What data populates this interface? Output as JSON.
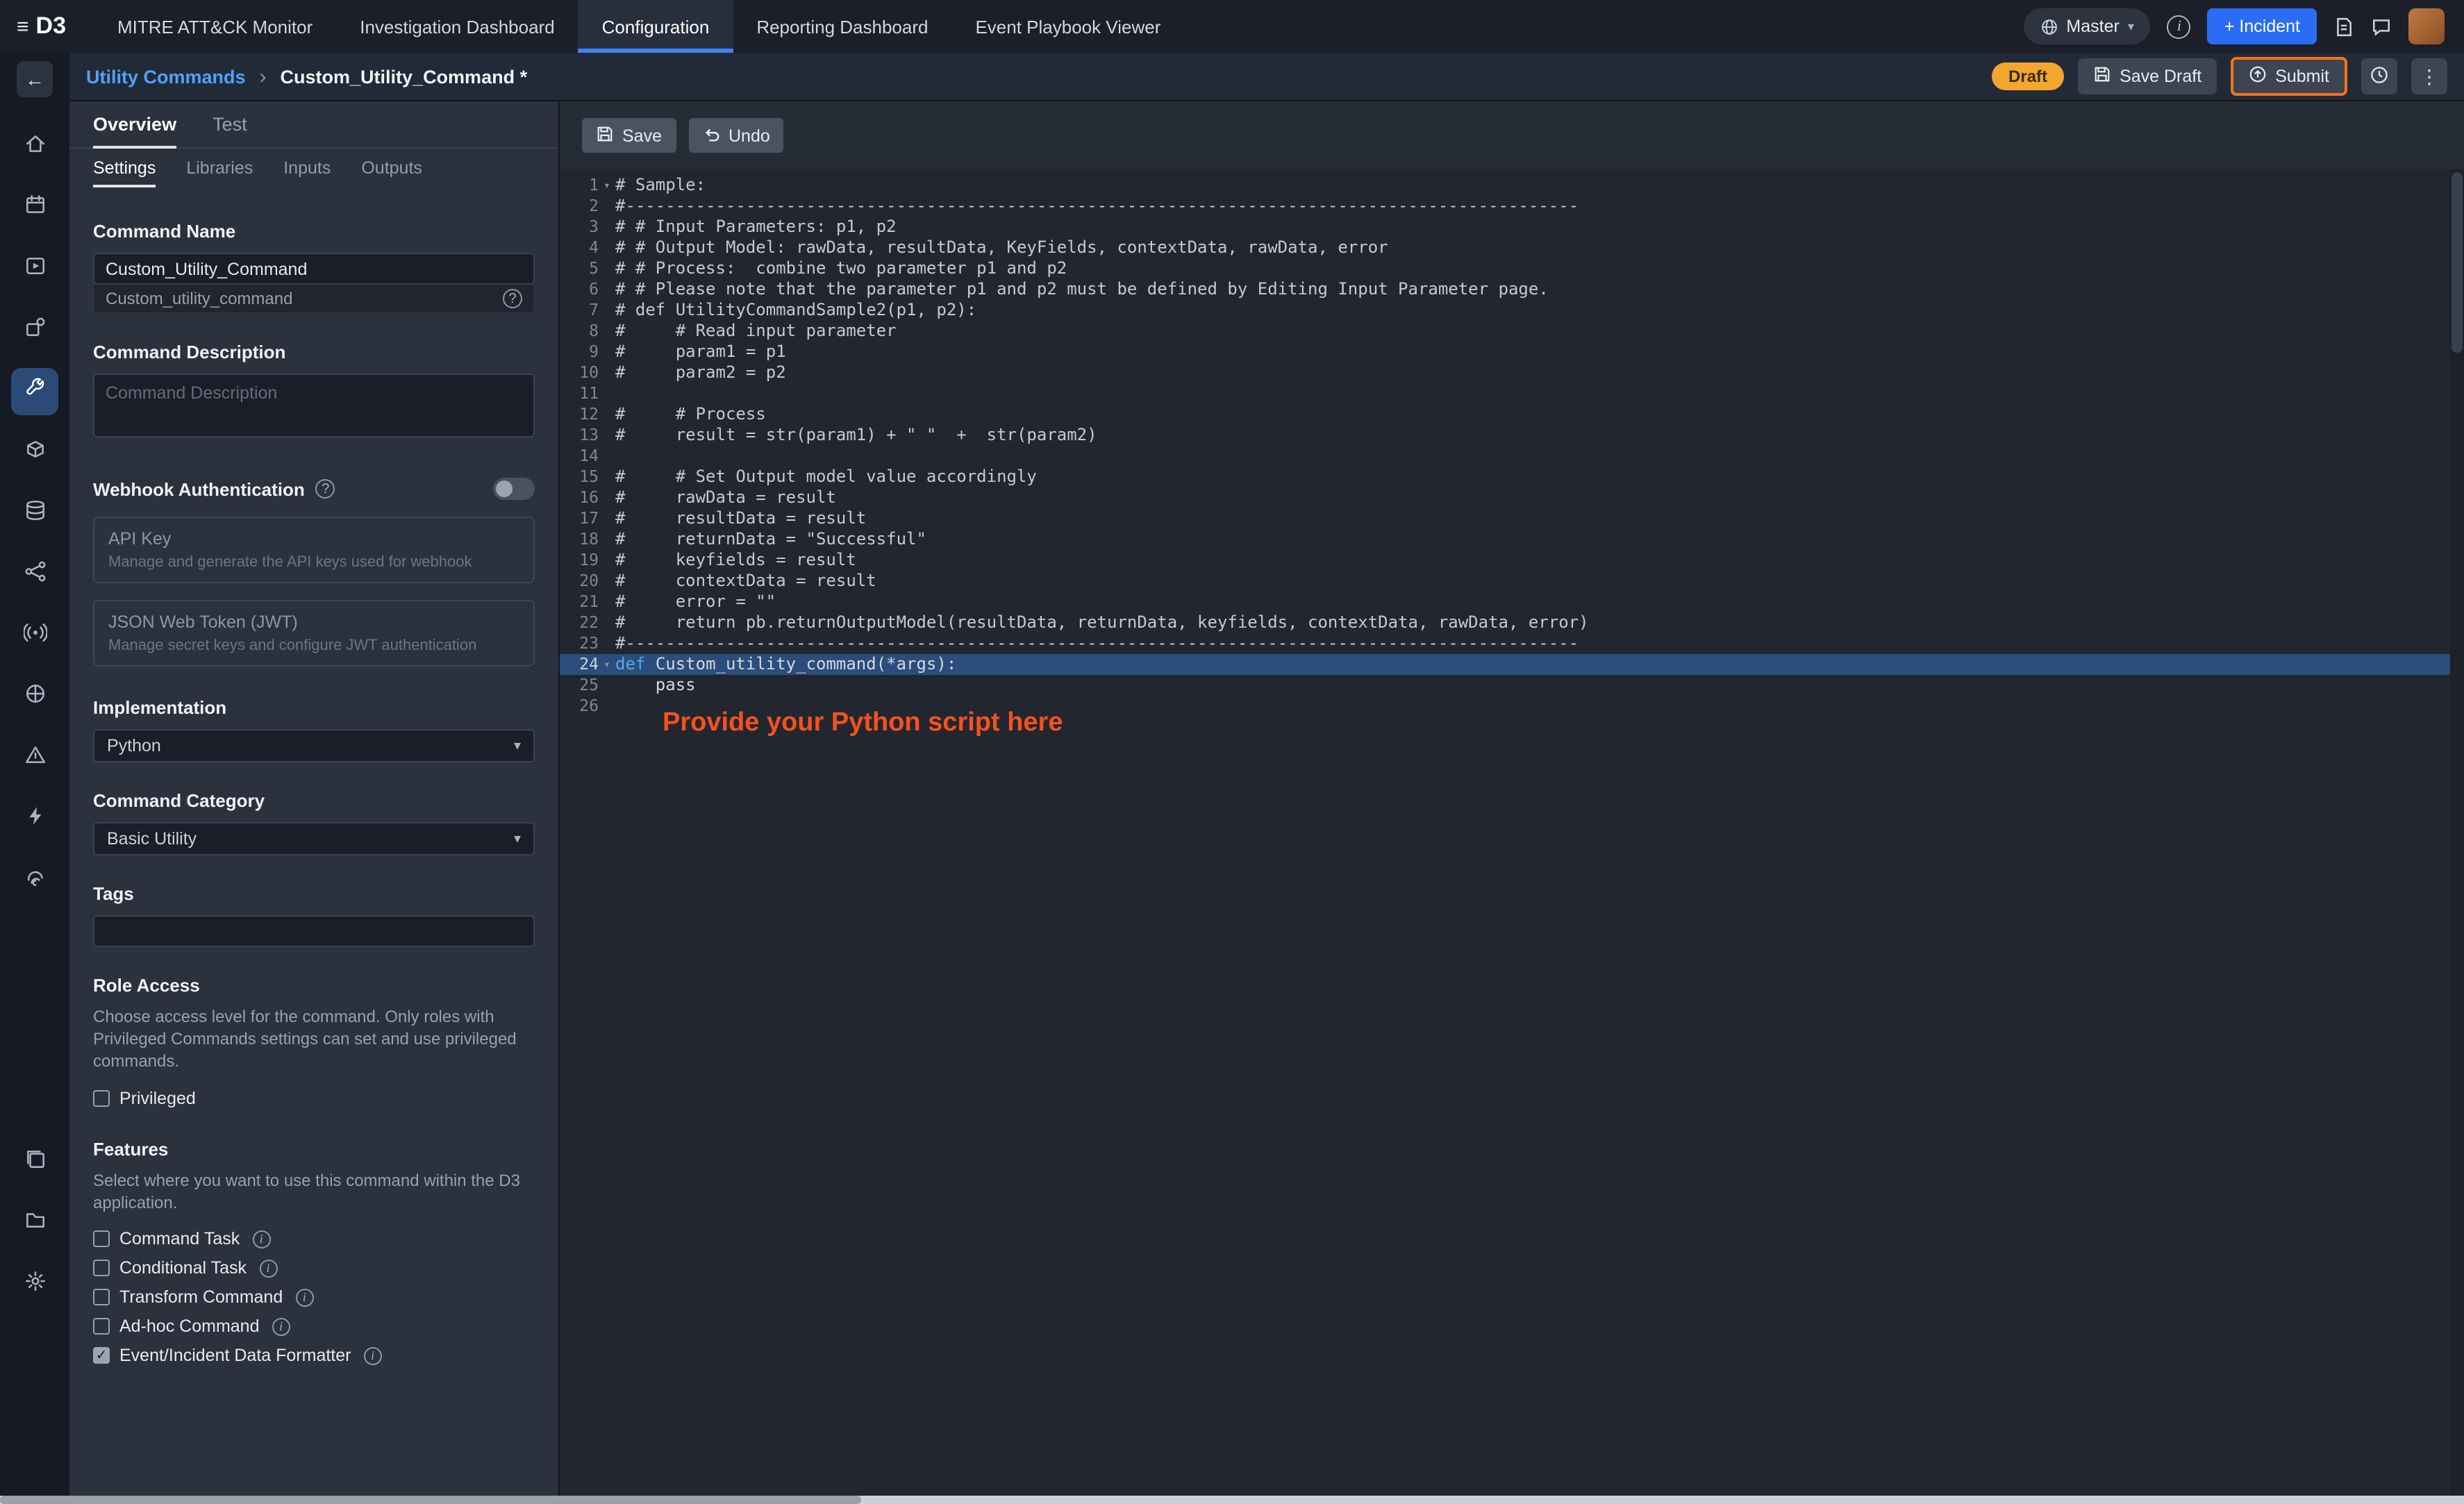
{
  "topnav": {
    "logo": "D3",
    "items": [
      "MITRE ATT&CK Monitor",
      "Investigation Dashboard",
      "Configuration",
      "Reporting Dashboard",
      "Event Playbook Viewer"
    ],
    "active_index": 2,
    "master": "Master",
    "incident_button": "+ Incident"
  },
  "header": {
    "breadcrumb_parent": "Utility Commands",
    "breadcrumb_current": "Custom_Utility_Command *",
    "draft_badge": "Draft",
    "save_draft": "Save Draft",
    "submit": "Submit"
  },
  "rail": {
    "active": "utility-commands",
    "top": [
      "home",
      "calendar",
      "playbooks",
      "integrations",
      "utility-commands",
      "packages",
      "database",
      "connections",
      "data-ingestion",
      "global-lists",
      "labs",
      "automation",
      "fingerprint"
    ],
    "bottom": [
      "windows",
      "file-manager",
      "settings"
    ]
  },
  "panel": {
    "tabs": [
      "Overview",
      "Test"
    ],
    "subtabs": [
      "Settings",
      "Libraries",
      "Inputs",
      "Outputs"
    ],
    "command_name": {
      "label": "Command Name",
      "value": "Custom_Utility_Command",
      "hint": "Custom_utility_command"
    },
    "command_description": {
      "label": "Command Description",
      "placeholder": "Command Description"
    },
    "webhook": {
      "label": "Webhook Authentication",
      "api_key": {
        "title": "API Key",
        "description": "Manage and generate the API keys used for webhook"
      },
      "jwt": {
        "title": "JSON Web Token (JWT)",
        "description": "Manage secret keys and configure JWT authentication"
      }
    },
    "implementation": {
      "label": "Implementation",
      "value": "Python"
    },
    "category": {
      "label": "Command Category",
      "value": "Basic Utility"
    },
    "tags": {
      "label": "Tags"
    },
    "role_access": {
      "label": "Role Access",
      "description": "Choose access level for the command. Only roles with Privileged Commands settings can set and use privileged commands.",
      "checkbox_label": "Privileged",
      "checked": false
    },
    "features": {
      "label": "Features",
      "description": "Select where you want to use this command within the D3 application.",
      "items": [
        {
          "label": "Command Task",
          "checked": false
        },
        {
          "label": "Conditional Task",
          "checked": false
        },
        {
          "label": "Transform Command",
          "checked": false
        },
        {
          "label": "Ad-hoc Command",
          "checked": false
        },
        {
          "label": "Event/Incident Data Formatter",
          "checked": true
        }
      ]
    }
  },
  "editor": {
    "save": "Save",
    "undo": "Undo",
    "annotation": "Provide your Python script here",
    "highlight_line": 24,
    "lines": [
      {
        "n": 1,
        "t": "# Sample:",
        "fold": true
      },
      {
        "n": 2,
        "t": "#-----------------------------------------------------------------------------------------------"
      },
      {
        "n": 3,
        "t": "# # Input Parameters: p1, p2"
      },
      {
        "n": 4,
        "t": "# # Output Model: rawData, resultData, KeyFields, contextData, rawData, error"
      },
      {
        "n": 5,
        "t": "# # Process:  combine two parameter p1 and p2"
      },
      {
        "n": 6,
        "t": "# # Please note that the parameter p1 and p2 must be defined by Editing Input Parameter page."
      },
      {
        "n": 7,
        "t": "# def UtilityCommandSample2(p1, p2):"
      },
      {
        "n": 8,
        "t": "#     # Read input parameter"
      },
      {
        "n": 9,
        "t": "#     param1 = p1"
      },
      {
        "n": 10,
        "t": "#     param2 = p2"
      },
      {
        "n": 11,
        "t": ""
      },
      {
        "n": 12,
        "t": "#     # Process"
      },
      {
        "n": 13,
        "t": "#     result = str(param1) + \" \"  +  str(param2)"
      },
      {
        "n": 14,
        "t": ""
      },
      {
        "n": 15,
        "t": "#     # Set Output model value accordingly"
      },
      {
        "n": 16,
        "t": "#     rawData = result"
      },
      {
        "n": 17,
        "t": "#     resultData = result"
      },
      {
        "n": 18,
        "t": "#     returnData = \"Successful\""
      },
      {
        "n": 19,
        "t": "#     keyfields = result"
      },
      {
        "n": 20,
        "t": "#     contextData = result"
      },
      {
        "n": 21,
        "t": "#     error = \"\""
      },
      {
        "n": 22,
        "t": "#     return pb.returnOutputModel(resultData, returnData, keyfields, contextData, rawData, error)"
      },
      {
        "n": 23,
        "t": "#-----------------------------------------------------------------------------------------------"
      },
      {
        "n": 24,
        "t": "def Custom_utility_command(*args):",
        "fold": true
      },
      {
        "n": 25,
        "t": "    pass"
      },
      {
        "n": 26,
        "t": ""
      }
    ]
  }
}
